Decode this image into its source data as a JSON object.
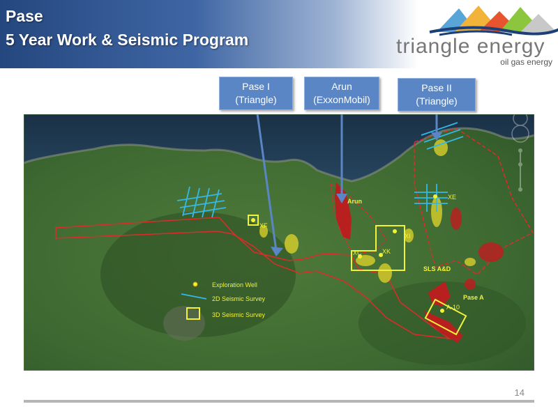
{
  "header": {
    "title_line1": "Pase",
    "title_line2": "5 Year Work & Seismic Program"
  },
  "logo": {
    "name": "triangle energy",
    "tagline": "oil gas energy"
  },
  "callouts": [
    {
      "line1": "Pase I",
      "line2": "(Triangle)"
    },
    {
      "line1": "Arun",
      "line2": "(ExxonMobil)"
    },
    {
      "line1": "Pase II",
      "line2": "(Triangle)"
    }
  ],
  "map": {
    "labels": {
      "arun": "Arun",
      "sls": "SLS A&D",
      "pase_a": "Pase A"
    },
    "wells": {
      "xf": "XF",
      "xe": "XE",
      "xc": "XC",
      "xk": "XK",
      "xi": "XI",
      "a10": "A-10"
    },
    "legend": {
      "well": "Exploration Well",
      "seismic2d": "2D Seismic Survey",
      "seismic3d": "3D Seismic Survey"
    }
  },
  "colors": {
    "accent": "#5b86c6",
    "block_outline": "#e02a2a",
    "field_fill": "#b82020",
    "yellow": "#f3f23a",
    "seismic2d": "#35b8e6"
  },
  "footer": {
    "page": "14"
  }
}
